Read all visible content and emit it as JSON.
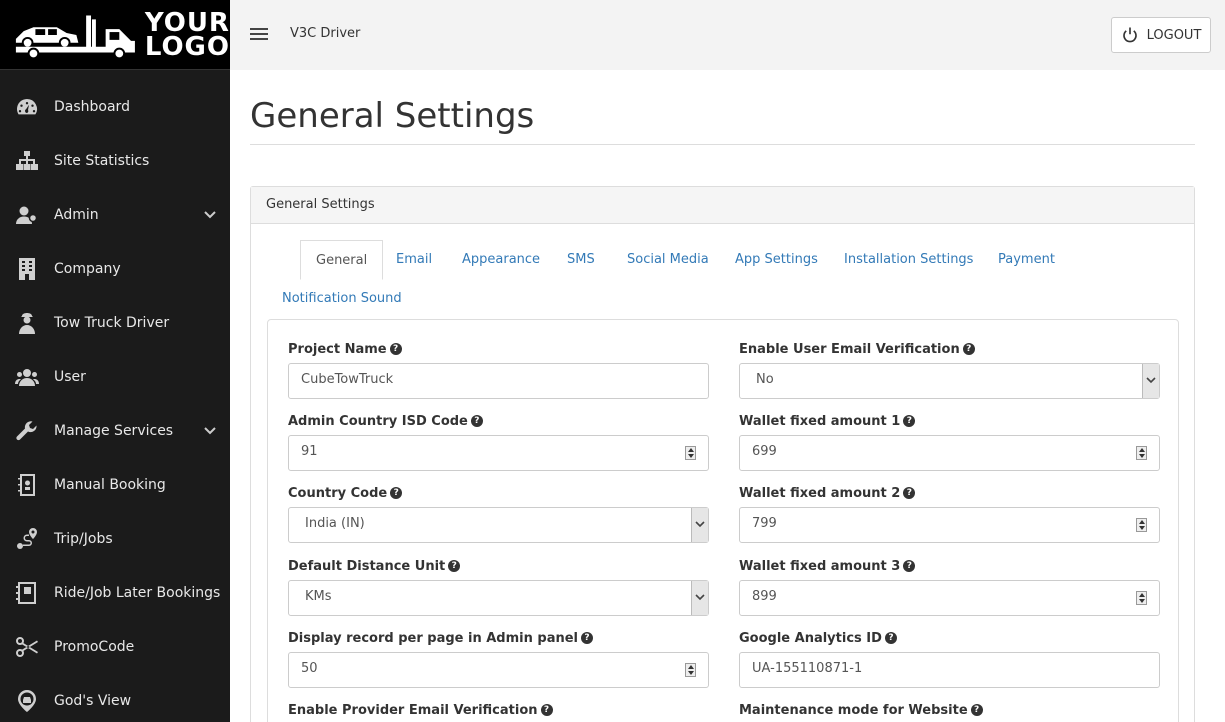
{
  "logo": {
    "line1": "YOUR",
    "line2": "LOGO"
  },
  "sidebar": {
    "items": [
      {
        "label": "Dashboard",
        "icon": "dashboard-icon"
      },
      {
        "label": "Site Statistics",
        "icon": "sitemap-icon"
      },
      {
        "label": "Admin",
        "icon": "admin-users-icon",
        "expandable": true
      },
      {
        "label": "Company",
        "icon": "building-icon"
      },
      {
        "label": "Tow Truck Driver",
        "icon": "driver-icon"
      },
      {
        "label": "User",
        "icon": "users-icon"
      },
      {
        "label": "Manage Services",
        "icon": "wrench-icon",
        "expandable": true
      },
      {
        "label": "Manual Booking",
        "icon": "notebook-icon"
      },
      {
        "label": "Trip/Jobs",
        "icon": "route-icon"
      },
      {
        "label": "Ride/Job Later Bookings",
        "icon": "calendar-book-icon"
      },
      {
        "label": "PromoCode",
        "icon": "scissors-icon"
      },
      {
        "label": "God's View",
        "icon": "map-pin-car-icon"
      }
    ]
  },
  "header": {
    "app_title": "V3C  Driver",
    "logout_label": "LOGOUT"
  },
  "page": {
    "title": "General Settings",
    "panel_title": "General Settings"
  },
  "tabs": [
    "General",
    "Email",
    "Appearance",
    "SMS",
    "Social Media",
    "App Settings",
    "Installation Settings",
    "Payment",
    "Notification Sound"
  ],
  "active_tab": "General",
  "form": {
    "project_name": {
      "label": "Project Name",
      "value": "CubeTowTruck"
    },
    "email_verification": {
      "label": "Enable User Email Verification",
      "value": "No"
    },
    "isd_code": {
      "label": "Admin Country ISD Code",
      "value": "91"
    },
    "wallet1": {
      "label": "Wallet fixed amount 1",
      "value": "699"
    },
    "country_code": {
      "label": "Country Code",
      "value": "India (IN)"
    },
    "wallet2": {
      "label": "Wallet fixed amount 2",
      "value": "799"
    },
    "distance_unit": {
      "label": "Default Distance Unit",
      "value": "KMs"
    },
    "wallet3": {
      "label": "Wallet fixed amount 3",
      "value": "899"
    },
    "records_per_page": {
      "label": "Display record per page in Admin panel",
      "value": "50"
    },
    "analytics_id": {
      "label": "Google Analytics ID",
      "value": "UA-155110871-1"
    },
    "provider_email_verification": {
      "label": "Enable Provider Email Verification"
    },
    "maintenance_mode": {
      "label": "Maintenance mode for Website"
    }
  }
}
